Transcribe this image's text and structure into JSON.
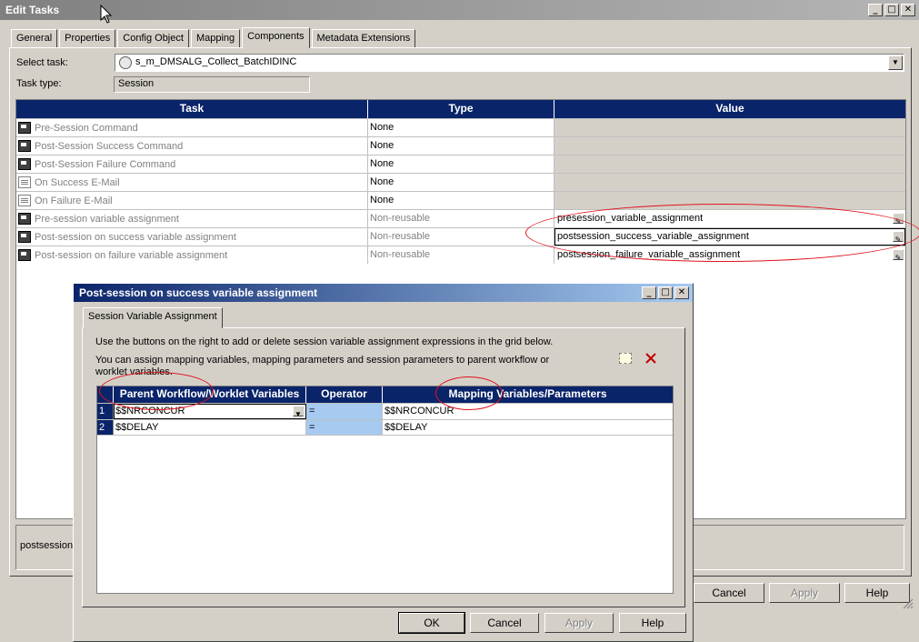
{
  "main_window": {
    "title": "Edit Tasks",
    "tabs": [
      "General",
      "Properties",
      "Config Object",
      "Mapping",
      "Components",
      "Metadata Extensions"
    ],
    "active_tab": "Components",
    "select_task_label": "Select task:",
    "select_task_value": "s_m_DMSALG_Collect_BatchIDINC",
    "task_type_label": "Task type:",
    "task_type_value": "Session",
    "grid": {
      "headers": [
        "Task",
        "Type",
        "Value"
      ],
      "rows": [
        {
          "task": "Pre-Session Command",
          "type": "None",
          "value": "",
          "icon": "command-icon"
        },
        {
          "task": "Post-Session Success Command",
          "type": "None",
          "value": "",
          "icon": "command-icon"
        },
        {
          "task": "Post-Session Failure Command",
          "type": "None",
          "value": "",
          "icon": "command-icon"
        },
        {
          "task": "On Success E-Mail",
          "type": "None",
          "value": "",
          "icon": "email-icon"
        },
        {
          "task": "On Failure E-Mail",
          "type": "None",
          "value": "",
          "icon": "email-icon"
        },
        {
          "task": "Pre-session variable assignment",
          "type": "Non-reusable",
          "value": "presession_variable_assignment",
          "icon": "command-icon"
        },
        {
          "task": "Post-session on success variable assignment",
          "type": "Non-reusable",
          "value": "postsession_success_variable_assignment",
          "icon": "command-icon"
        },
        {
          "task": "Post-session on failure variable assignment",
          "type": "Non-reusable",
          "value": "postsession_failure_variable_assignment",
          "icon": "command-icon"
        }
      ]
    },
    "description_text": "postsession_",
    "buttons": {
      "cancel": "Cancel",
      "apply": "Apply",
      "help": "Help"
    }
  },
  "sub_dialog": {
    "title": "Post-session on success variable assignment",
    "tab": "Session Variable Assignment",
    "instruction_1": "Use the buttons on the right to add or delete session variable assignment expressions in the grid below.",
    "instruction_2": "You can assign mapping variables, mapping parameters and session parameters to parent workflow or worklet variables.",
    "grid": {
      "headers": [
        "Parent Workflow/Worklet Variables",
        "Operator",
        "Mapping Variables/Parameters"
      ],
      "rows": [
        {
          "num": "1",
          "parent": "$$NRCONCUR",
          "op": "=",
          "mapping": "$$NRCONCUR"
        },
        {
          "num": "2",
          "parent": "$$DELAY",
          "op": "=",
          "mapping": "$$DELAY"
        }
      ]
    },
    "buttons": {
      "ok": "OK",
      "cancel": "Cancel",
      "apply": "Apply",
      "help": "Help"
    }
  },
  "colors": {
    "header_blue": "#0a246a",
    "annotation_red": "#e0141e",
    "face": "#d4d0c8"
  }
}
